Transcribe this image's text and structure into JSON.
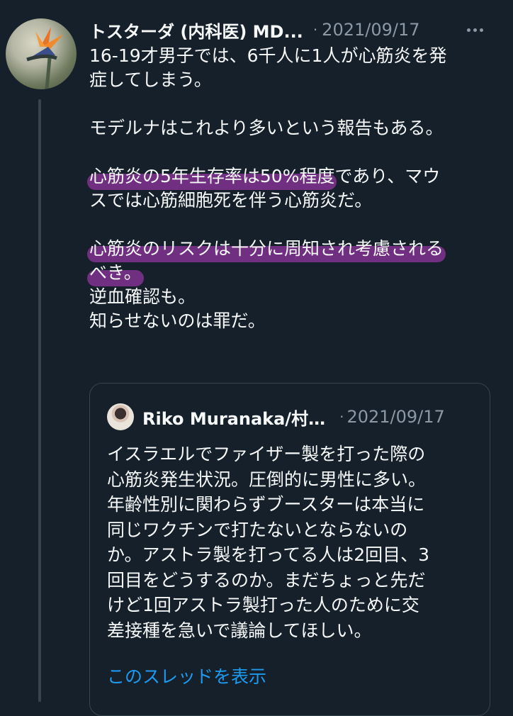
{
  "tweet": {
    "author_name": "トスターダ (内科医) MD...",
    "separator": "·",
    "date": "2021/09/17",
    "lines": [
      "16-19才男子では、6千人に1人が心筋炎を発",
      "症してしまう。",
      "モデルナはこれより多いという報告もある。",
      "心筋炎の5年生存率は50%程度",
      "であり、マウ",
      "スでは心筋細胞死を伴う心筋炎だ。",
      "心筋炎のリスクは十分に周知され考慮される",
      "べき。",
      "逆血確認も。",
      "知らせないのは罪だ。"
    ]
  },
  "quoted": {
    "author_name": "Riko Muranaka/村…",
    "separator": "·",
    "date": "2021/09/17",
    "lines": [
      "イスラエルでファイザー製を打った際の",
      "心筋炎発生状況。圧倒的に男性に多い。",
      "年齢性別に関わらずブースターは本当に",
      "同じワクチンで打たないとならないの",
      "か。アストラ製を打ってる人は2回目、3",
      "回目をどうするのか。まだちょっと先だ",
      "けど1回アストラ製打った人のために交",
      "差接種を急いで議論してほしい。"
    ],
    "show_thread_label": "このスレッドを表示"
  },
  "colors": {
    "background": "#15202b",
    "text": "#f7f9f9",
    "muted": "#8b98a5",
    "link": "#1d9bf0",
    "highlight": "#be3cc8",
    "border": "#38444d"
  }
}
